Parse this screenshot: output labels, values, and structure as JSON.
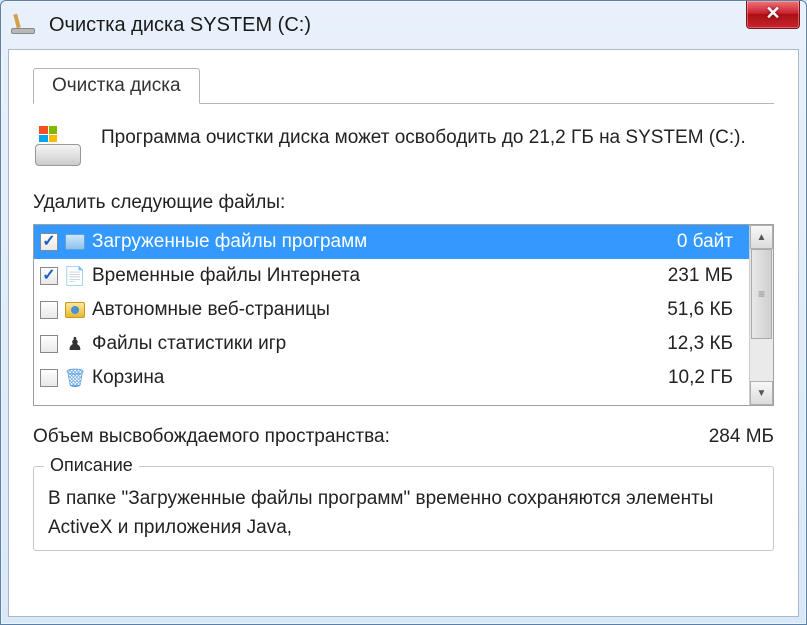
{
  "window": {
    "title": "Очистка диска SYSTEM (C:)"
  },
  "tab": {
    "label": "Очистка диска"
  },
  "info": {
    "text": "Программа очистки диска может освободить до 21,2 ГБ на SYSTEM (C:)."
  },
  "listLabel": "Удалить следующие файлы:",
  "files": [
    {
      "checked": true,
      "icon": "folder",
      "label": "Загруженные файлы программ",
      "size": "0 байт",
      "selected": true
    },
    {
      "checked": true,
      "icon": "ie",
      "label": "Временные файлы Интернета",
      "size": "231 МБ",
      "selected": false
    },
    {
      "checked": false,
      "icon": "web",
      "label": "Автономные веб-страницы",
      "size": "51,6 КБ",
      "selected": false
    },
    {
      "checked": false,
      "icon": "chess",
      "label": "Файлы статистики игр",
      "size": "12,3 КБ",
      "selected": false
    },
    {
      "checked": false,
      "icon": "bin",
      "label": "Корзина",
      "size": "10,2 ГБ",
      "selected": false
    }
  ],
  "summary": {
    "label": "Объем высвобождаемого пространства:",
    "value": "284 МБ"
  },
  "description": {
    "legend": "Описание",
    "text": "В папке \"Загруженные файлы программ\" временно сохраняются элементы ActiveX и приложения Java,"
  }
}
